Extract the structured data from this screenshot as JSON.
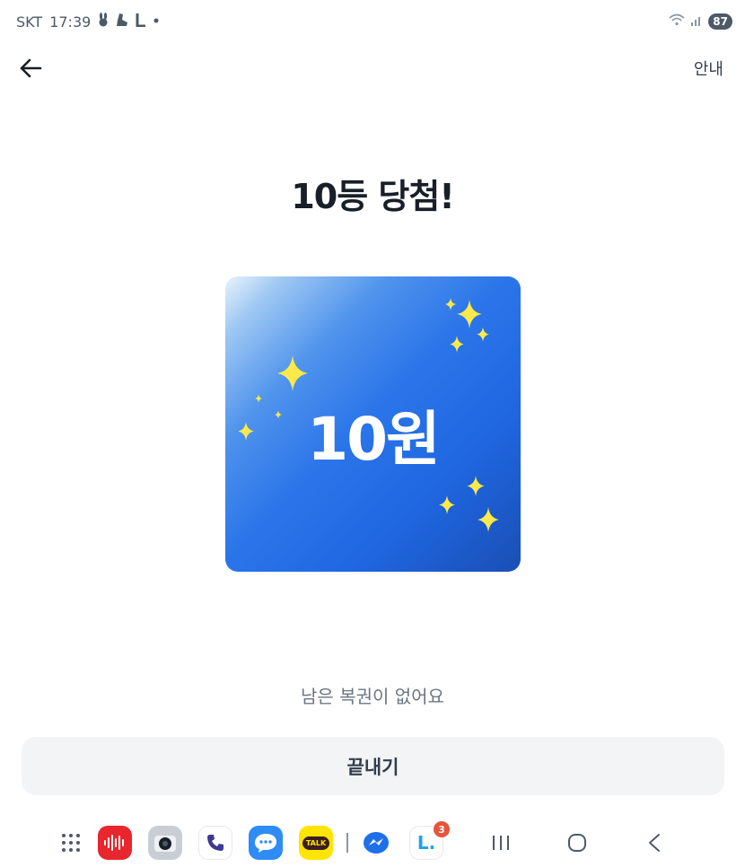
{
  "status_bar": {
    "carrier": "SKT",
    "time": "17:39",
    "battery": "87",
    "left_icons": [
      "rabbit-icon",
      "shoe-icon",
      "line-l-icon",
      "dot-icon"
    ],
    "right_icons": [
      "wifi-icon",
      "signal-icon"
    ]
  },
  "header": {
    "back_icon": "arrow-left-icon",
    "info_label": "안내"
  },
  "result": {
    "title": "10등 당첨!",
    "prize": "10원",
    "card_colors": {
      "start": "#e9f3fb",
      "end": "#1a4fb5"
    },
    "sparkle_color": "#ffe94a"
  },
  "notice": "남은 복권이 없어요",
  "finish_button": {
    "label": "끝내기"
  },
  "dock": {
    "apps": [
      "apps-grid-icon",
      "voice-recorder-icon",
      "camera-icon",
      "phone-icon",
      "messages-icon",
      "kakaotalk-icon",
      "messenger-icon",
      "line-app-icon"
    ],
    "kakao_label": "TALK",
    "line_label": "L.",
    "line_badge": "3",
    "nav": [
      "recents-nav-icon",
      "home-nav-icon",
      "back-nav-icon"
    ]
  }
}
